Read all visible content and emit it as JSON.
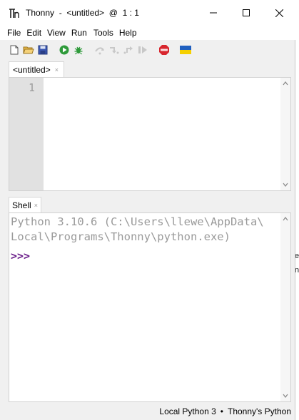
{
  "window": {
    "title": "Thonny  -  <untitled>  @  1 : 1",
    "controls": [
      "minimize",
      "maximize",
      "close"
    ]
  },
  "menu": {
    "items": [
      "File",
      "Edit",
      "View",
      "Run",
      "Tools",
      "Help"
    ]
  },
  "toolbar": {
    "buttons": [
      "new-file",
      "open-file",
      "save",
      "run",
      "debug",
      "step-over",
      "step-into",
      "step-out",
      "resume",
      "stop",
      "ukraine-flag"
    ]
  },
  "editor": {
    "tab_label": "<untitled>",
    "tab_close": "×",
    "line_numbers": [
      "1"
    ]
  },
  "shell": {
    "tab_label": "Shell",
    "tab_close": "×",
    "output_line1": "Python 3.10.6 (C:\\Users\\llewe\\AppData\\",
    "output_line2": "Local\\Programs\\Thonny\\python.exe)",
    "prompt": ">>>"
  },
  "status": {
    "interpreter": "Local Python 3",
    "separator": "•",
    "python": "Thonny's Python"
  },
  "colors": {
    "prompt": "#6b1f8a",
    "run_green": "#2e9a3a",
    "stop_red": "#d8262e",
    "flag_blue": "#1f5fbf",
    "flag_yellow": "#f5d000"
  }
}
